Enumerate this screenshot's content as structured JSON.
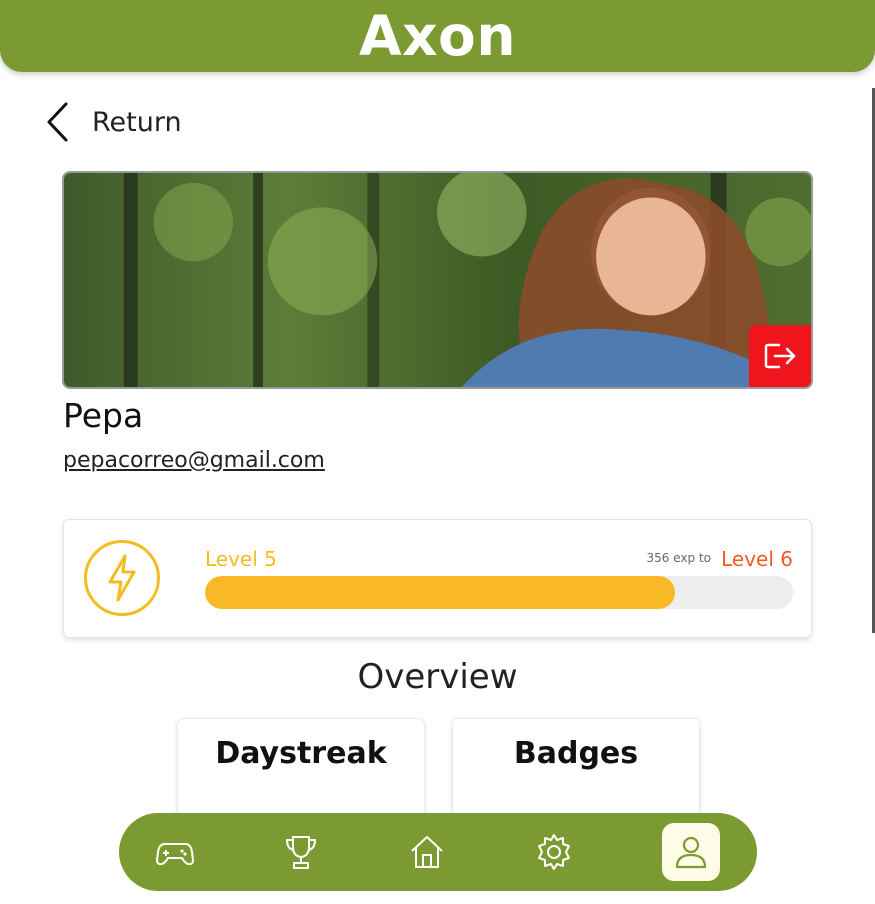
{
  "app": {
    "title": "Axon"
  },
  "nav": {
    "back_label": "Return"
  },
  "profile": {
    "name": "Pepa",
    "email": "pepacorreo@gmail.com"
  },
  "level": {
    "current_label": "Level 5",
    "exp_text": "356 exp to",
    "next_label": "Level 6",
    "progress_fraction": 0.8
  },
  "overview": {
    "title": "Overview",
    "cards": [
      "Daystreak",
      "Badges"
    ]
  },
  "bottom_nav": {
    "items": [
      "gamepad-icon",
      "trophy-icon",
      "home-icon",
      "settings-icon",
      "profile-icon"
    ],
    "active": "profile-icon"
  },
  "colors": {
    "brand_green": "#7c9a32",
    "level_yellow": "#f6bc1f",
    "next_level_orange": "#f05a22",
    "logout_red": "#f0141c"
  }
}
